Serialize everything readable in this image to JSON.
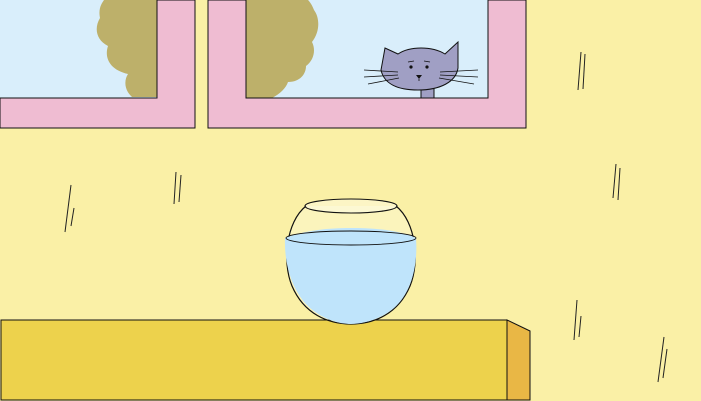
{
  "scene": {
    "colors": {
      "wall": "#faf0a6",
      "sky": "#d9eefb",
      "tree": "#bdb06a",
      "window_frame": "#efbcd2",
      "shelf_front": "#edd24c",
      "shelf_side": "#e9b745",
      "water": "#bfe4fb",
      "cat": "#a09fc4",
      "outline": "#111111"
    },
    "icons": [
      "cat-icon",
      "fishbowl-icon",
      "tree-icon",
      "window-icon",
      "shelf-icon"
    ]
  }
}
